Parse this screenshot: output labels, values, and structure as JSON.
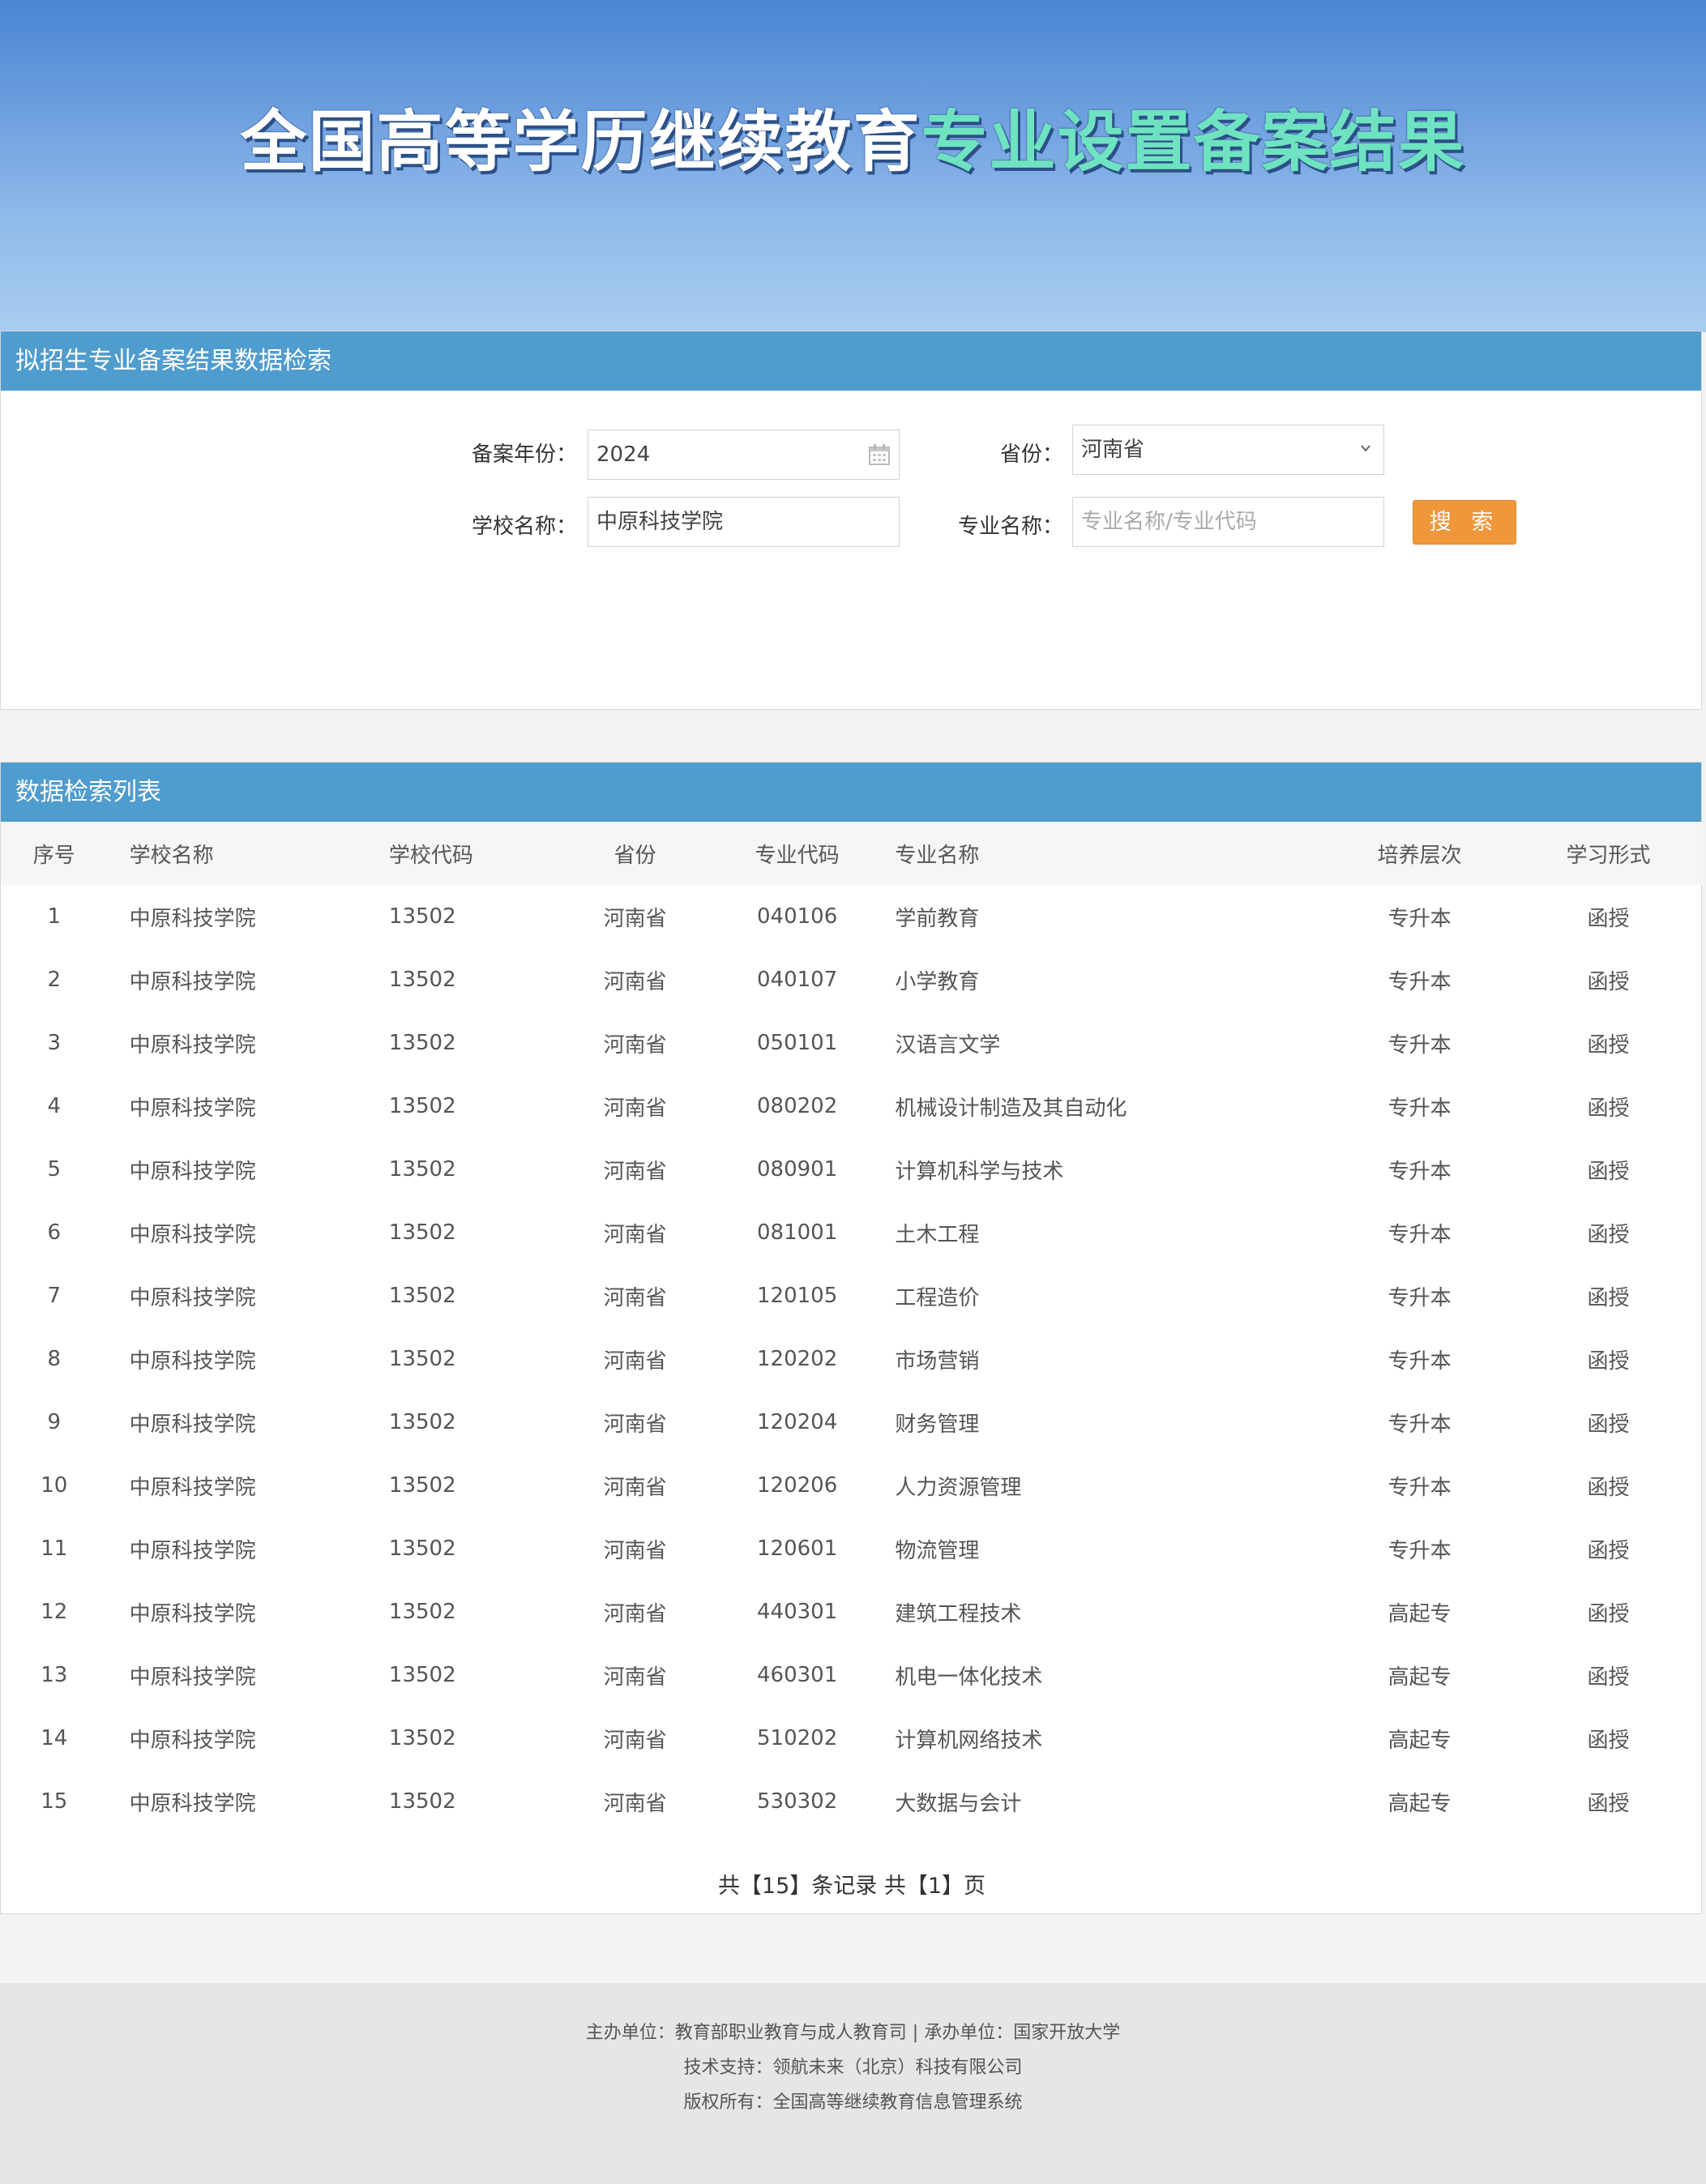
{
  "banner": {
    "title_part1": "全国高等学历继续教育",
    "title_part2": "专业设置备案结果"
  },
  "search": {
    "heading": "拟招生专业备案结果数据检索",
    "year_label": "备案年份：",
    "year_value": "2024",
    "province_label": "省份：",
    "province_value": "河南省",
    "school_label": "学校名称：",
    "school_value": "中原科技学院",
    "major_label": "专业名称：",
    "major_placeholder": "专业名称/专业代码",
    "search_button": "搜 索"
  },
  "list": {
    "heading": "数据检索列表",
    "columns": [
      "序号",
      "学校名称",
      "学校代码",
      "省份",
      "专业代码",
      "专业名称",
      "培养层次",
      "学习形式"
    ],
    "rows": [
      [
        "1",
        "中原科技学院",
        "13502",
        "河南省",
        "040106",
        "学前教育",
        "专升本",
        "函授"
      ],
      [
        "2",
        "中原科技学院",
        "13502",
        "河南省",
        "040107",
        "小学教育",
        "专升本",
        "函授"
      ],
      [
        "3",
        "中原科技学院",
        "13502",
        "河南省",
        "050101",
        "汉语言文学",
        "专升本",
        "函授"
      ],
      [
        "4",
        "中原科技学院",
        "13502",
        "河南省",
        "080202",
        "机械设计制造及其自动化",
        "专升本",
        "函授"
      ],
      [
        "5",
        "中原科技学院",
        "13502",
        "河南省",
        "080901",
        "计算机科学与技术",
        "专升本",
        "函授"
      ],
      [
        "6",
        "中原科技学院",
        "13502",
        "河南省",
        "081001",
        "土木工程",
        "专升本",
        "函授"
      ],
      [
        "7",
        "中原科技学院",
        "13502",
        "河南省",
        "120105",
        "工程造价",
        "专升本",
        "函授"
      ],
      [
        "8",
        "中原科技学院",
        "13502",
        "河南省",
        "120202",
        "市场营销",
        "专升本",
        "函授"
      ],
      [
        "9",
        "中原科技学院",
        "13502",
        "河南省",
        "120204",
        "财务管理",
        "专升本",
        "函授"
      ],
      [
        "10",
        "中原科技学院",
        "13502",
        "河南省",
        "120206",
        "人力资源管理",
        "专升本",
        "函授"
      ],
      [
        "11",
        "中原科技学院",
        "13502",
        "河南省",
        "120601",
        "物流管理",
        "专升本",
        "函授"
      ],
      [
        "12",
        "中原科技学院",
        "13502",
        "河南省",
        "440301",
        "建筑工程技术",
        "高起专",
        "函授"
      ],
      [
        "13",
        "中原科技学院",
        "13502",
        "河南省",
        "460301",
        "机电一体化技术",
        "高起专",
        "函授"
      ],
      [
        "14",
        "中原科技学院",
        "13502",
        "河南省",
        "510202",
        "计算机网络技术",
        "高起专",
        "函授"
      ],
      [
        "15",
        "中原科技学院",
        "13502",
        "河南省",
        "530302",
        "大数据与会计",
        "高起专",
        "函授"
      ]
    ],
    "pager": "共【15】条记录 共【1】页"
  },
  "footer": {
    "line1": "主办单位：教育部职业教育与成人教育司 | 承办单位：国家开放大学",
    "line2": "技术支持：领航未来（北京）科技有限公司",
    "line3": "版权所有：全国高等继续教育信息管理系统"
  },
  "colors": {
    "header_bar": "#4f9ccf",
    "search_button": "#f0963b",
    "title_accent": "#6fe3c1"
  },
  "icons": {
    "year_field": "calendar-icon",
    "province_field": "chevron-down-icon"
  }
}
